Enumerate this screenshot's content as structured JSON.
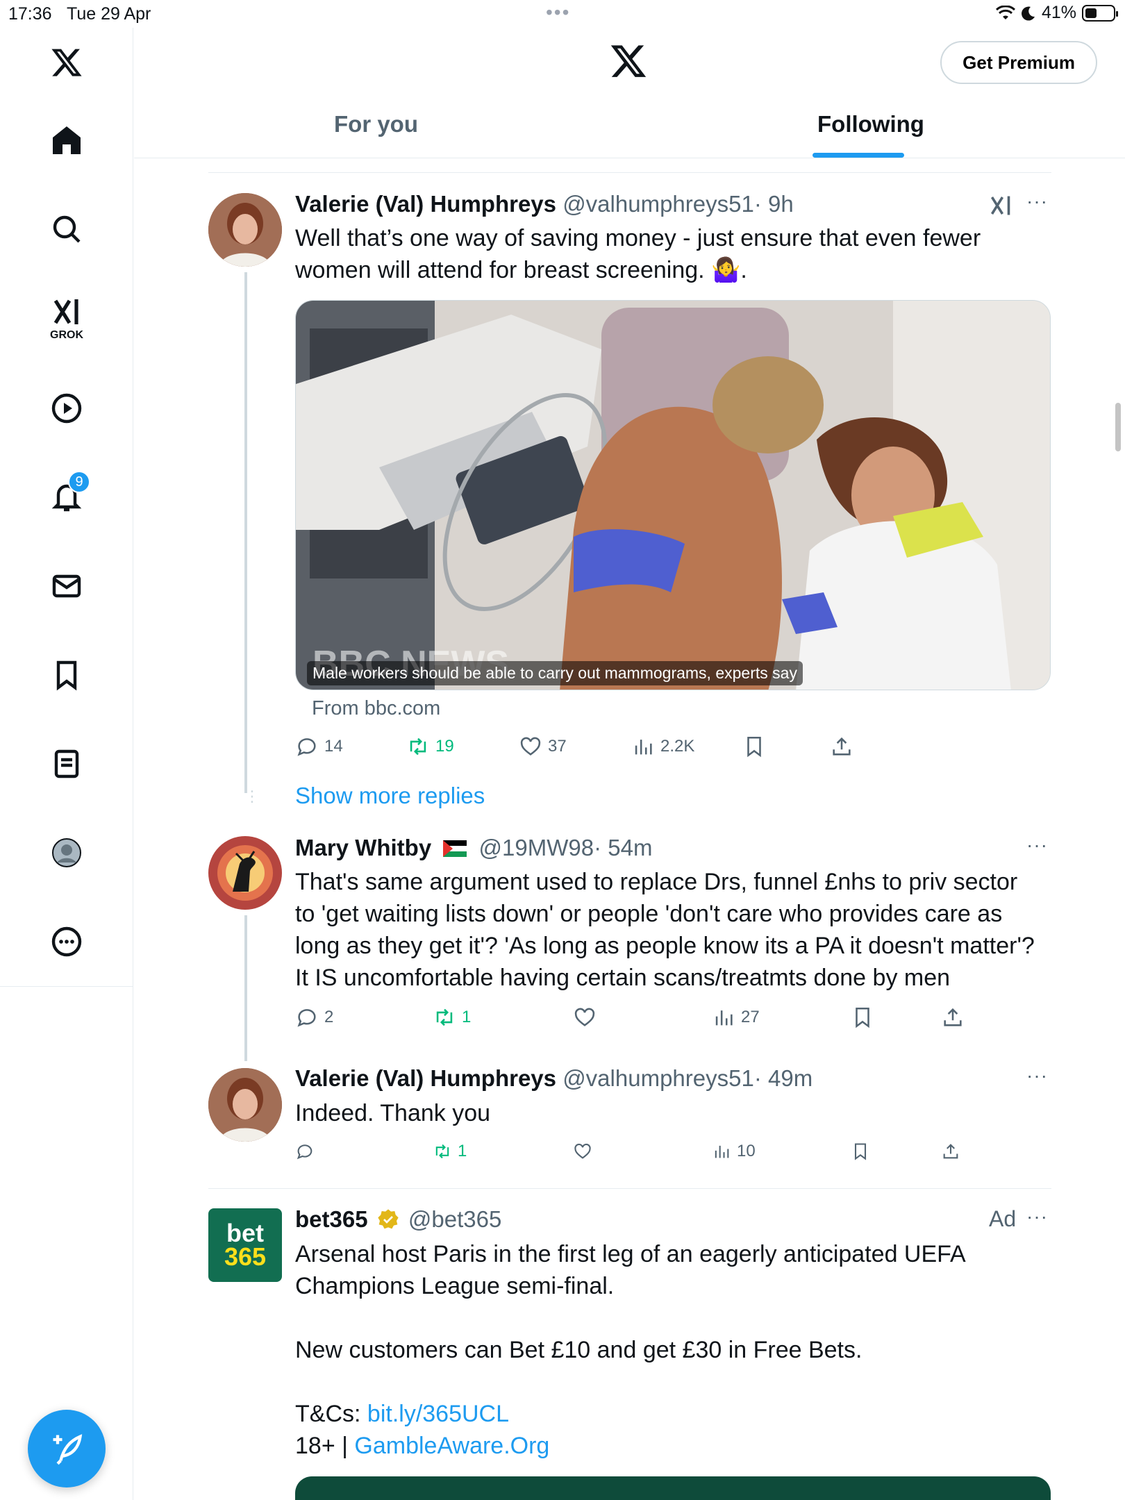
{
  "status_bar": {
    "time": "17:36",
    "date": "Tue 29 Apr",
    "battery": "41%",
    "battery_level": 0.41
  },
  "sidebar": {
    "grok_label": "GROK",
    "notifications_badge": "9",
    "items": [
      "x-logo",
      "home-icon",
      "search-icon",
      "grok-icon",
      "video-icon",
      "bell-icon",
      "mail-icon",
      "bookmark-icon",
      "lists-icon",
      "profile-icon",
      "more-icon"
    ]
  },
  "header": {
    "premium_label": "Get Premium",
    "tabs": [
      {
        "label": "For you",
        "active": false
      },
      {
        "label": "Following",
        "active": true
      }
    ]
  },
  "tweets": [
    {
      "name": "Valerie (Val) Humphreys",
      "handle": "@valhumphreys51",
      "time": "· 9h",
      "text_line1": "Well that’s one way of saving money - just ensure that even fewer",
      "text_line2": "women will attend for breast screening. 🤷‍♀️.",
      "media_caption": "Male workers should be able to carry out mammograms, experts say",
      "media_watermark": "BBC NEWS",
      "from": "From bbc.com",
      "replies": "14",
      "retweets": "19",
      "likes": "37",
      "views": "2.2K"
    },
    {
      "show_more": "Show more replies"
    },
    {
      "name": "Mary Whitby",
      "handle": "@19MW98",
      "time": "· 54m",
      "text_lines": [
        "That's same argument used to replace Drs, funnel £nhs to priv sector",
        "to 'get waiting lists down' or people 'don't care who provides care as",
        "long as they get it'? 'As long as people know its a PA it doesn't matter'?",
        "It IS uncomfortable having certain scans/treatmts done by men"
      ],
      "replies": "2",
      "retweets": "1",
      "likes": "",
      "views": "27"
    },
    {
      "name": "Valerie (Val) Humphreys",
      "handle": "@valhumphreys51",
      "time": "· 49m",
      "text": "Indeed. Thank you",
      "replies": "",
      "retweets": "1",
      "likes": "",
      "views": "10"
    },
    {
      "name": "bet365",
      "handle": "@bet365",
      "ad_label": "Ad",
      "avatar_top": "bet",
      "avatar_bottom": "365",
      "text_line1": "Arsenal host Paris in the first leg of an eagerly anticipated UEFA",
      "text_line2": "Champions League semi-final.",
      "text_line3": "New customers can Bet £10 and get £30 in Free Bets.",
      "tcs_label": "T&Cs: ",
      "tcs_link": "bit.ly/365UCL",
      "age_label": "18+ | ",
      "gamble_link": "GambleAware.Org"
    }
  ],
  "colors": {
    "accent": "#1d9bf0",
    "retweet": "#00ba7c",
    "muted": "#536471",
    "bet365_green": "#126e51",
    "bet365_yellow": "#ffdf1b"
  }
}
